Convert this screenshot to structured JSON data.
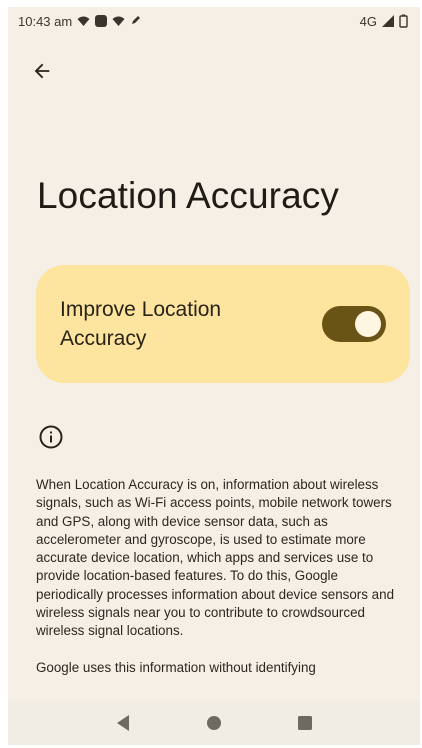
{
  "status_bar": {
    "time": "10:43 am",
    "network": "4G"
  },
  "page": {
    "title": "Location Accuracy"
  },
  "toggle": {
    "label": "Improve Location Accuracy",
    "state": "on"
  },
  "description": {
    "paragraph_1": "When Location Accuracy is on, information about wireless signals, such as Wi-Fi access points, mobile network towers and GPS, along with device sensor data, such as accelerometer and gyroscope, is used to estimate more accurate device location, which apps and services use to provide location-based features. To do this, Google periodically processes information about device sensors and wireless signals near you to contribute to crowdsourced wireless signal locations.",
    "paragraph_2": "Google uses this information without identifying"
  },
  "colors": {
    "background": "#f6efe6",
    "card": "#fde49f",
    "switch_track": "#6a5415"
  }
}
